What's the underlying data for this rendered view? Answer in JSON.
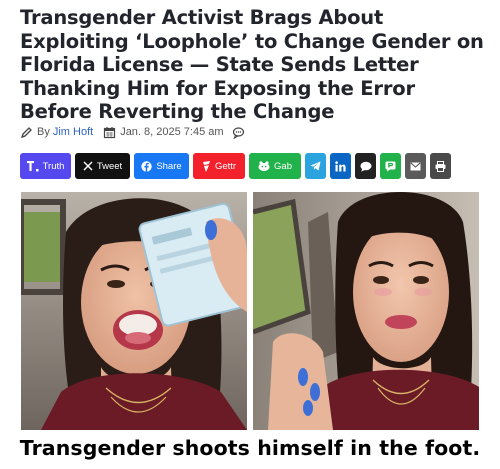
{
  "article": {
    "headline": "Transgender Activist Brags About Exploiting ‘Loophole’ to Change Gender on Florida License — State Sends Letter Thanking Him for Exposing the Error Before Reverting the Change",
    "by_label": "By",
    "author": "Jim Hoft",
    "date": "Jan. 8, 2025 7:45 am"
  },
  "share": {
    "truth": "Truth",
    "tweet": "Tweet",
    "facebook": "Share",
    "gettr": "Gettr",
    "gab": "Gab"
  },
  "colors": {
    "truth": "#5448ee",
    "tweet": "#111111",
    "facebook": "#1877f2",
    "gettr": "#f2212c",
    "gab": "#21b24b",
    "telegram": "#2aa3df",
    "linkedin": "#0a66c2",
    "comments": "#222222",
    "green_sq": "#21b24b",
    "email": "#5a5a5a",
    "print": "#4a4a4a"
  },
  "icons": [
    "pencil-icon",
    "calendar-icon",
    "comment-icon",
    "truth-icon",
    "x-icon",
    "facebook-icon",
    "gettr-icon",
    "gab-icon",
    "telegram-icon",
    "linkedin-icon",
    "chat-icon",
    "share-green-icon",
    "email-icon",
    "print-icon"
  ],
  "caption": "Transgender shoots himself in the foot."
}
